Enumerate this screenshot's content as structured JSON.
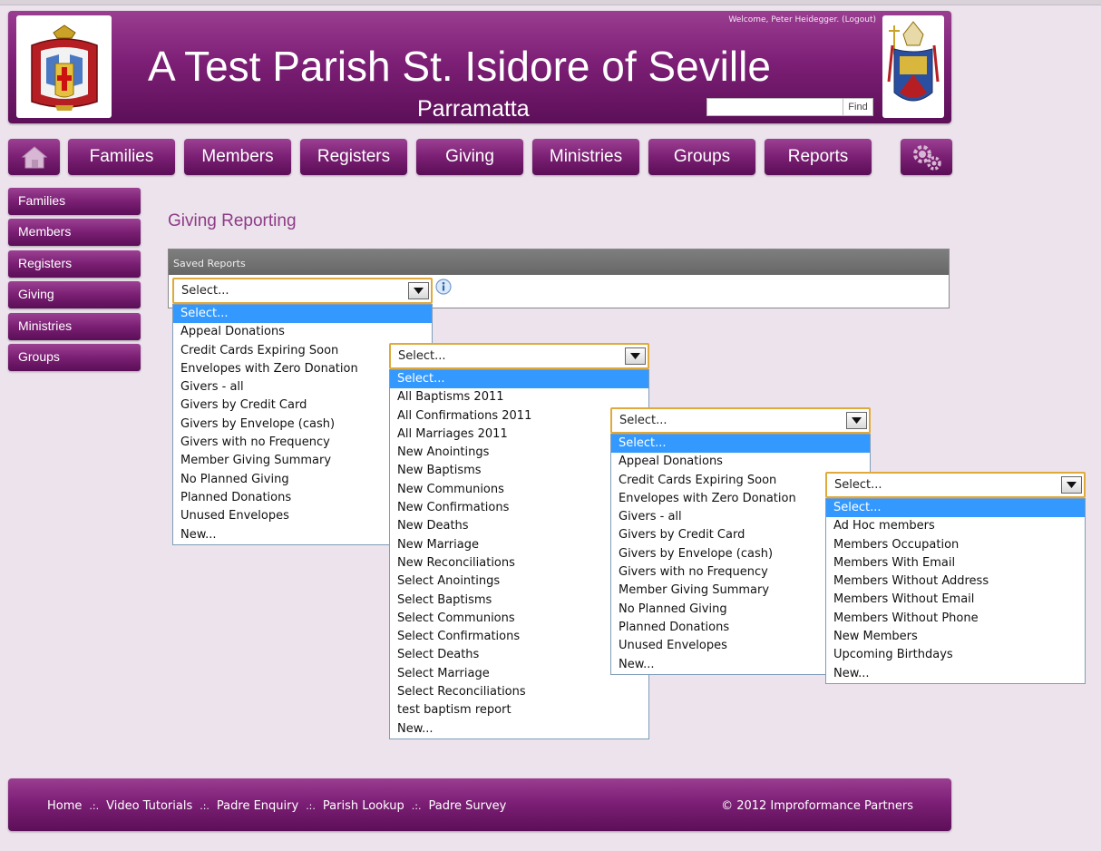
{
  "header": {
    "title": "A Test Parish St. Isidore of Seville",
    "subtitle": "Parramatta",
    "welcome": "Welcome, Peter Heidegger. (Logout)",
    "search_value": "",
    "find_label": "Find"
  },
  "nav": {
    "home_icon": "house-icon",
    "items": [
      "Families",
      "Members",
      "Registers",
      "Giving",
      "Ministries",
      "Groups",
      "Reports"
    ],
    "settings_icon": "gears-icon"
  },
  "sidebar": {
    "items": [
      "Families",
      "Members",
      "Registers",
      "Giving",
      "Ministries",
      "Groups"
    ]
  },
  "main": {
    "page_title": "Giving Reporting",
    "panel_label": "Saved Reports",
    "info_icon": "info-icon"
  },
  "dropdowns": [
    {
      "selected": "Select...",
      "options": [
        "Select...",
        "Appeal Donations",
        "Credit Cards Expiring Soon",
        "Envelopes with Zero Donation",
        "Givers - all",
        "Givers by Credit Card",
        "Givers by Envelope (cash)",
        "Givers with no Frequency",
        "Member Giving Summary",
        "No Planned Giving",
        "Planned Donations",
        "Unused Envelopes",
        "New..."
      ]
    },
    {
      "selected": "Select...",
      "options": [
        "Select...",
        "All Baptisms 2011",
        "All Confirmations 2011",
        "All Marriages 2011",
        "New Anointings",
        "New Baptisms",
        "New Communions",
        "New Confirmations",
        "New Deaths",
        "New Marriage",
        "New Reconciliations",
        "Select Anointings",
        "Select Baptisms",
        "Select Communions",
        "Select Confirmations",
        "Select Deaths",
        "Select Marriage",
        "Select Reconciliations",
        "test baptism report",
        "New..."
      ]
    },
    {
      "selected": "Select...",
      "options": [
        "Select...",
        "Appeal Donations",
        "Credit Cards Expiring Soon",
        "Envelopes with Zero Donation",
        "Givers - all",
        "Givers by Credit Card",
        "Givers by Envelope (cash)",
        "Givers with no Frequency",
        "Member Giving Summary",
        "No Planned Giving",
        "Planned Donations",
        "Unused Envelopes",
        "New..."
      ]
    },
    {
      "selected": "Select...",
      "options": [
        "Select...",
        "Ad Hoc members",
        "Members Occupation",
        "Members With Email",
        "Members Without Address",
        "Members Without Email",
        "Members Without Phone",
        "New Members",
        "Upcoming Birthdays",
        "New..."
      ]
    }
  ],
  "footer": {
    "links": [
      "Home",
      "Video Tutorials",
      "Padre Enquiry",
      "Parish Lookup",
      "Padre Survey"
    ],
    "separator": ".:.",
    "copyright": "© 2012 Improformance Partners"
  },
  "colors": {
    "brand_purple": "#7d1f76",
    "highlight_blue": "#3399ff",
    "select_border": "#e0a93b"
  }
}
